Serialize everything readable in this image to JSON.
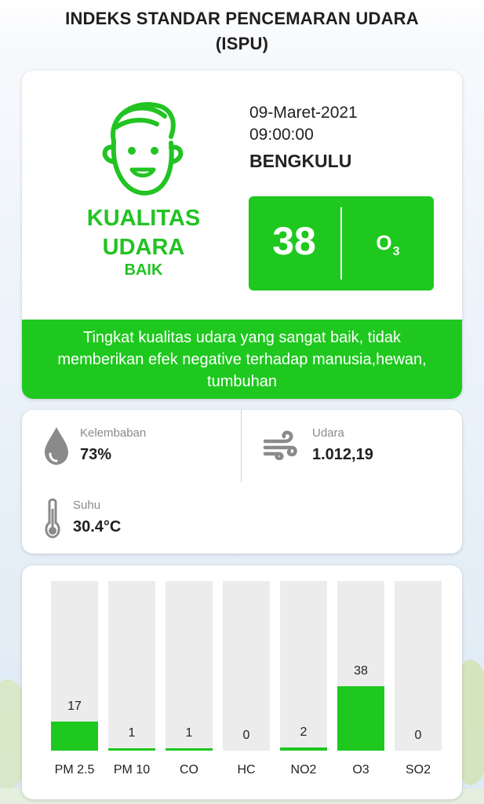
{
  "title_line1": "INDEKS STANDAR PENCEMARAN UDARA",
  "title_line2": "(ISPU)",
  "colors": {
    "accent_green": "#1ec81e",
    "face_green": "#22c322",
    "bar_track": "#ececec"
  },
  "summary": {
    "face_icon": "happy-face-icon",
    "quality_line1": "KUALITAS",
    "quality_line2": "UDARA",
    "quality_status": "BAIK",
    "date": "09-Maret-2021",
    "time": "09:00:00",
    "city": "BENGKULU",
    "index_value": "38",
    "pollutant_base": "O",
    "pollutant_sub": "3",
    "description": "Tingkat kualitas udara yang sangat baik, tidak memberikan efek negative terhadap manusia,hewan, tumbuhan"
  },
  "weather": {
    "humidity": {
      "icon": "water-drop-icon",
      "label": "Kelembaban",
      "value": "73%"
    },
    "air": {
      "icon": "wind-icon",
      "label": "Udara",
      "value": "1.012,19"
    },
    "temperature": {
      "icon": "thermometer-icon",
      "label": "Suhu",
      "value": "30.4°C"
    }
  },
  "chart_data": {
    "type": "bar",
    "categories": [
      "PM 2.5",
      "PM 10",
      "CO",
      "HC",
      "NO2",
      "O3",
      "SO2"
    ],
    "values": [
      17,
      1,
      1,
      0,
      2,
      38,
      0
    ],
    "value_labels": [
      "17",
      "1",
      "1",
      "0",
      "2",
      "38",
      "0"
    ],
    "ylim": [
      0,
      100
    ],
    "grid": false,
    "title": "",
    "xlabel": "",
    "ylabel": ""
  }
}
